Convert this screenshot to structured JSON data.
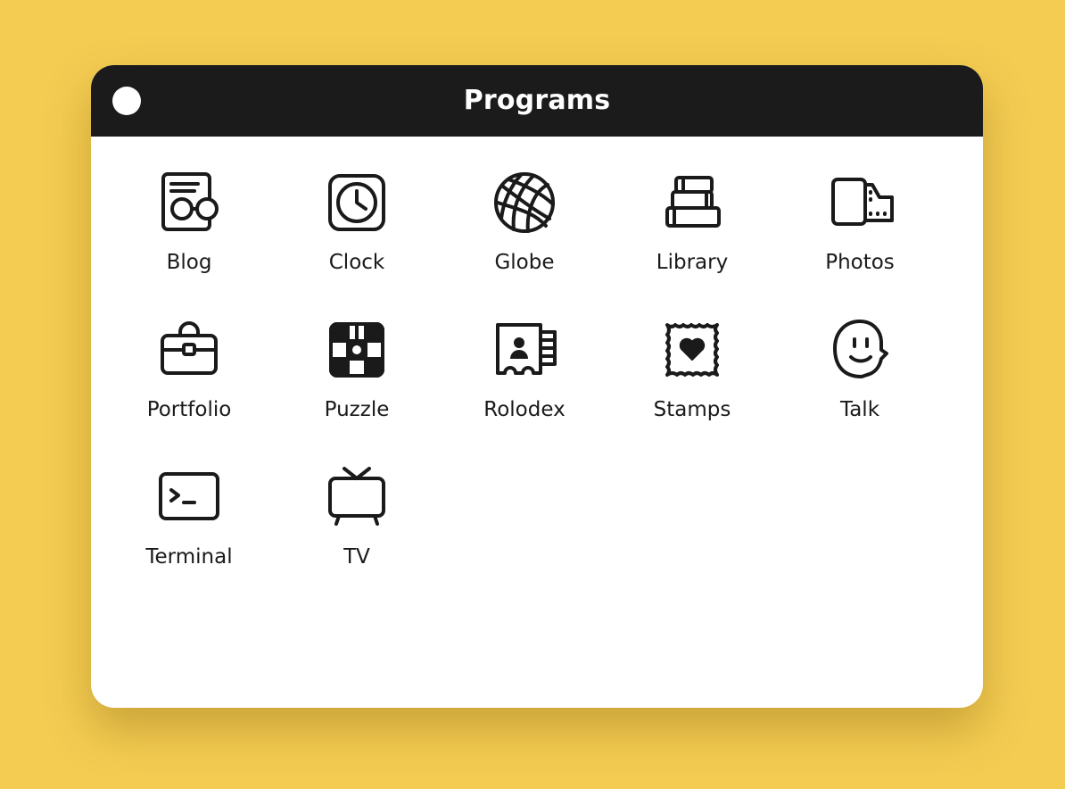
{
  "window": {
    "title": "Programs",
    "close_button": "close-button"
  },
  "colors": {
    "background": "#F4CC52",
    "titlebar": "#1B1B1B",
    "window": "#FFFFFF",
    "icon_stroke": "#1A1A1A"
  },
  "apps": [
    {
      "label": "Blog",
      "icon": "blog-icon"
    },
    {
      "label": "Clock",
      "icon": "clock-icon"
    },
    {
      "label": "Globe",
      "icon": "globe-icon"
    },
    {
      "label": "Library",
      "icon": "library-icon"
    },
    {
      "label": "Photos",
      "icon": "photos-icon"
    },
    {
      "label": "Portfolio",
      "icon": "portfolio-icon"
    },
    {
      "label": "Puzzle",
      "icon": "puzzle-icon"
    },
    {
      "label": "Rolodex",
      "icon": "rolodex-icon"
    },
    {
      "label": "Stamps",
      "icon": "stamps-icon"
    },
    {
      "label": "Talk",
      "icon": "talk-icon"
    },
    {
      "label": "Terminal",
      "icon": "terminal-icon"
    },
    {
      "label": "TV",
      "icon": "tv-icon"
    }
  ]
}
